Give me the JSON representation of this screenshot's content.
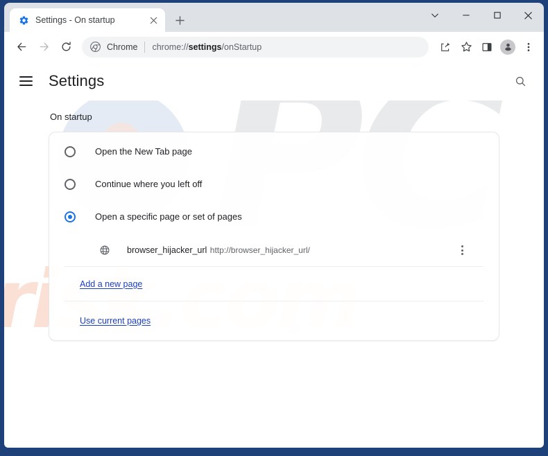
{
  "window": {
    "controls": {
      "tab_search_label": "Search tabs",
      "minimize_label": "Minimize",
      "maximize_label": "Maximize",
      "close_label": "Close"
    }
  },
  "tabstrip": {
    "tab": {
      "title": "Settings - On startup",
      "favicon": "gear-icon",
      "close_label": "Close tab"
    },
    "new_tab_label": "New Tab"
  },
  "toolbar": {
    "back_label": "Back",
    "forward_label": "Forward",
    "reload_label": "Reload",
    "omnibox": {
      "chip_label": "Chrome",
      "url_prefix": "chrome://",
      "url_bold": "settings",
      "url_suffix": "/onStartup",
      "full_url": "chrome://settings/onStartup"
    },
    "share_label": "Share this page",
    "bookmark_label": "Bookmark this tab",
    "side_panel_label": "Side panel",
    "profile_label": "Profile",
    "menu_label": "Customize and control Google Chrome"
  },
  "settings": {
    "title": "Settings",
    "menu_label": "Main menu",
    "search_label": "Search settings",
    "section_label": "On startup",
    "options": [
      {
        "label": "Open the New Tab page",
        "checked": false
      },
      {
        "label": "Continue where you left off",
        "checked": false
      },
      {
        "label": "Open a specific page or set of pages",
        "checked": true
      }
    ],
    "startup_pages": [
      {
        "name": "browser_hijacker_url",
        "url": "http://browser_hijacker_url/",
        "icon": "globe-icon",
        "menu_label": "More actions"
      }
    ],
    "links": {
      "add_new_page": "Add a new page",
      "use_current_pages": "Use current pages"
    }
  },
  "watermark": {
    "primary": "PC",
    "secondary": "risk.com"
  },
  "colors": {
    "frame": "#1e4179",
    "accent": "#1a73e8",
    "link": "#1a3fbf",
    "titlebar": "#dee1e6",
    "omnibox": "#f1f3f4"
  }
}
